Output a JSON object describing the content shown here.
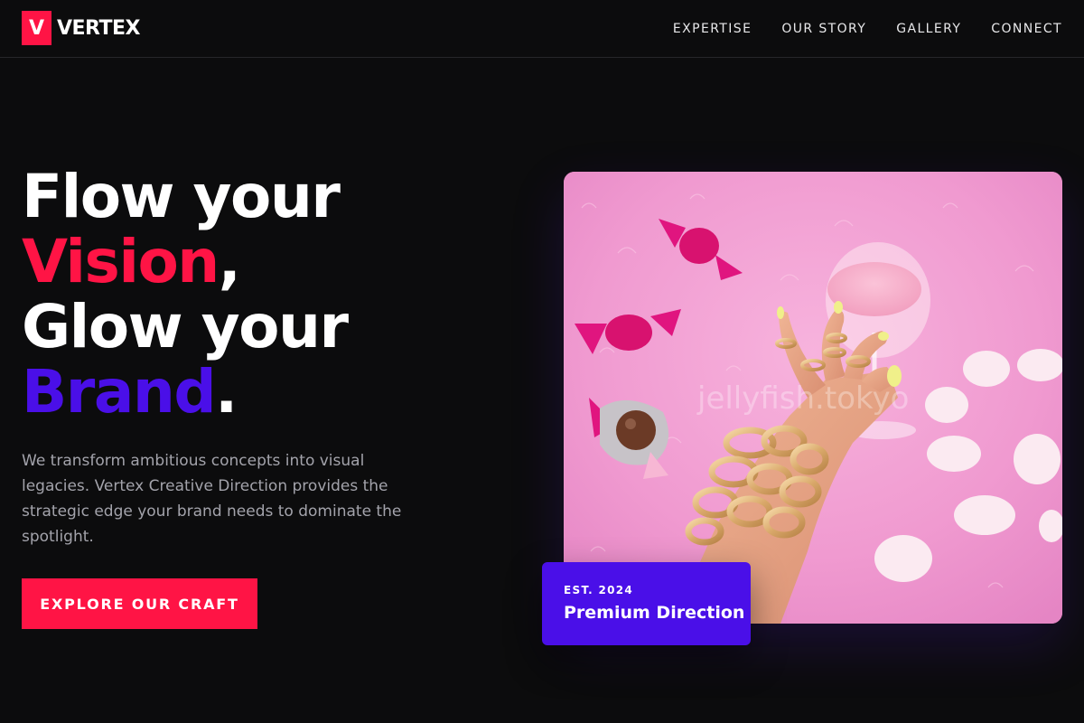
{
  "brand": {
    "mark": "V",
    "name": "VERTEX"
  },
  "nav": {
    "items": [
      {
        "label": "EXPERTISE"
      },
      {
        "label": "OUR STORY"
      },
      {
        "label": "GALLERY"
      },
      {
        "label": "CONNECT"
      }
    ]
  },
  "hero": {
    "line1": "Flow your",
    "line2_accent": "Vision",
    "line2_punct": ",",
    "line3": "Glow your",
    "line4_accent": "Brand",
    "line4_punct": ".",
    "description": "We transform ambitious concepts into visual legacies. Vertex Creative Direction provides the strategic edge your brand needs to dominate the spotlight.",
    "cta_label": "EXPLORE OUR CRAFT"
  },
  "image": {
    "watermark": "jellyfish.tokyo"
  },
  "badge": {
    "est": "EST. 2024",
    "title": "Premium Direction"
  },
  "colors": {
    "background": "#0c0c0d",
    "accent_red": "#ff1445",
    "accent_purple": "#4a0fe8",
    "muted_text": "#a3a3ab",
    "image_pink": "#f29ad0"
  }
}
